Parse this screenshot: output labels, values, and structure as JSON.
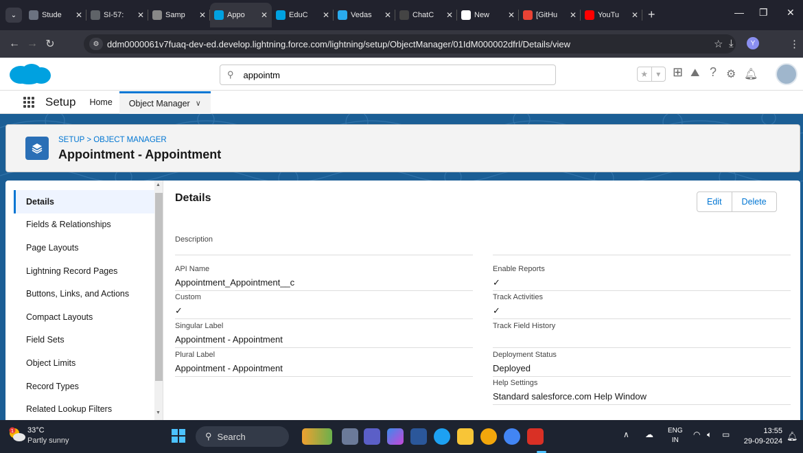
{
  "browser": {
    "tabs": [
      {
        "label": "Stude",
        "icon": "doc-icon",
        "color": "#6b7280"
      },
      {
        "label": "SI-57:",
        "icon": "slides-icon",
        "color": "#5f6368"
      },
      {
        "label": "Samp",
        "icon": "globe-icon",
        "color": "#888888"
      },
      {
        "label": "Appo",
        "icon": "salesforce-icon",
        "color": "#00a1e0"
      },
      {
        "label": "EduC",
        "icon": "salesforce-icon",
        "color": "#00a1e0"
      },
      {
        "label": "Vedas",
        "icon": "telegram-icon",
        "color": "#2aabee"
      },
      {
        "label": "ChatC",
        "icon": "chatgpt-icon",
        "color": "#444444"
      },
      {
        "label": "New",
        "icon": "github-icon",
        "color": "#ffffff"
      },
      {
        "label": "[GitHu",
        "icon": "gmail-icon",
        "color": "#ea4335"
      },
      {
        "label": "YouTu",
        "icon": "youtube-icon",
        "color": "#ff0000"
      }
    ],
    "active_tab_index": 3,
    "url": "ddm0000061v7fuaq-dev-ed.develop.lightning.force.com/lightning/setup/ObjectManager/01IdM000002dfrl/Details/view",
    "profile_initial": "Y"
  },
  "header": {
    "search_value": "appointm"
  },
  "context_nav": {
    "app_name": "Setup",
    "home_label": "Home",
    "object_manager_label": "Object Manager"
  },
  "page_header": {
    "breadcrumb": "SETUP > OBJECT MANAGER",
    "title": "Appointment - Appointment"
  },
  "left_nav": {
    "items": [
      "Details",
      "Fields & Relationships",
      "Page Layouts",
      "Lightning Record Pages",
      "Buttons, Links, and Actions",
      "Compact Layouts",
      "Field Sets",
      "Object Limits",
      "Record Types",
      "Related Lookup Filters"
    ],
    "selected_index": 0
  },
  "details": {
    "title": "Details",
    "edit_label": "Edit",
    "delete_label": "Delete",
    "description_label": "Description",
    "description_value": "",
    "left_fields": [
      {
        "label": "API Name",
        "value": "Appointment_Appointment__c"
      },
      {
        "label": "Custom",
        "value": "✓"
      },
      {
        "label": "Singular Label",
        "value": "Appointment - Appointment"
      },
      {
        "label": "Plural Label",
        "value": "Appointment - Appointment"
      }
    ],
    "right_fields": [
      {
        "label": "Enable Reports",
        "value": "✓"
      },
      {
        "label": "Track Activities",
        "value": "✓"
      },
      {
        "label": "Track Field History",
        "value": ""
      },
      {
        "label": "Deployment Status",
        "value": "Deployed"
      },
      {
        "label": "Help Settings",
        "value": "Standard salesforce.com Help Window"
      }
    ]
  },
  "taskbar": {
    "weather_badge": "1",
    "temperature": "33°C",
    "weather_desc": "Partly sunny",
    "search_label": "Search",
    "lang_line1": "ENG",
    "lang_line2": "IN",
    "time": "13:55",
    "date": "29-09-2024"
  },
  "colors": {
    "brand_blue": "#0176d3",
    "banner": "#1b5e95",
    "object_icon": "#2a6fb6"
  }
}
